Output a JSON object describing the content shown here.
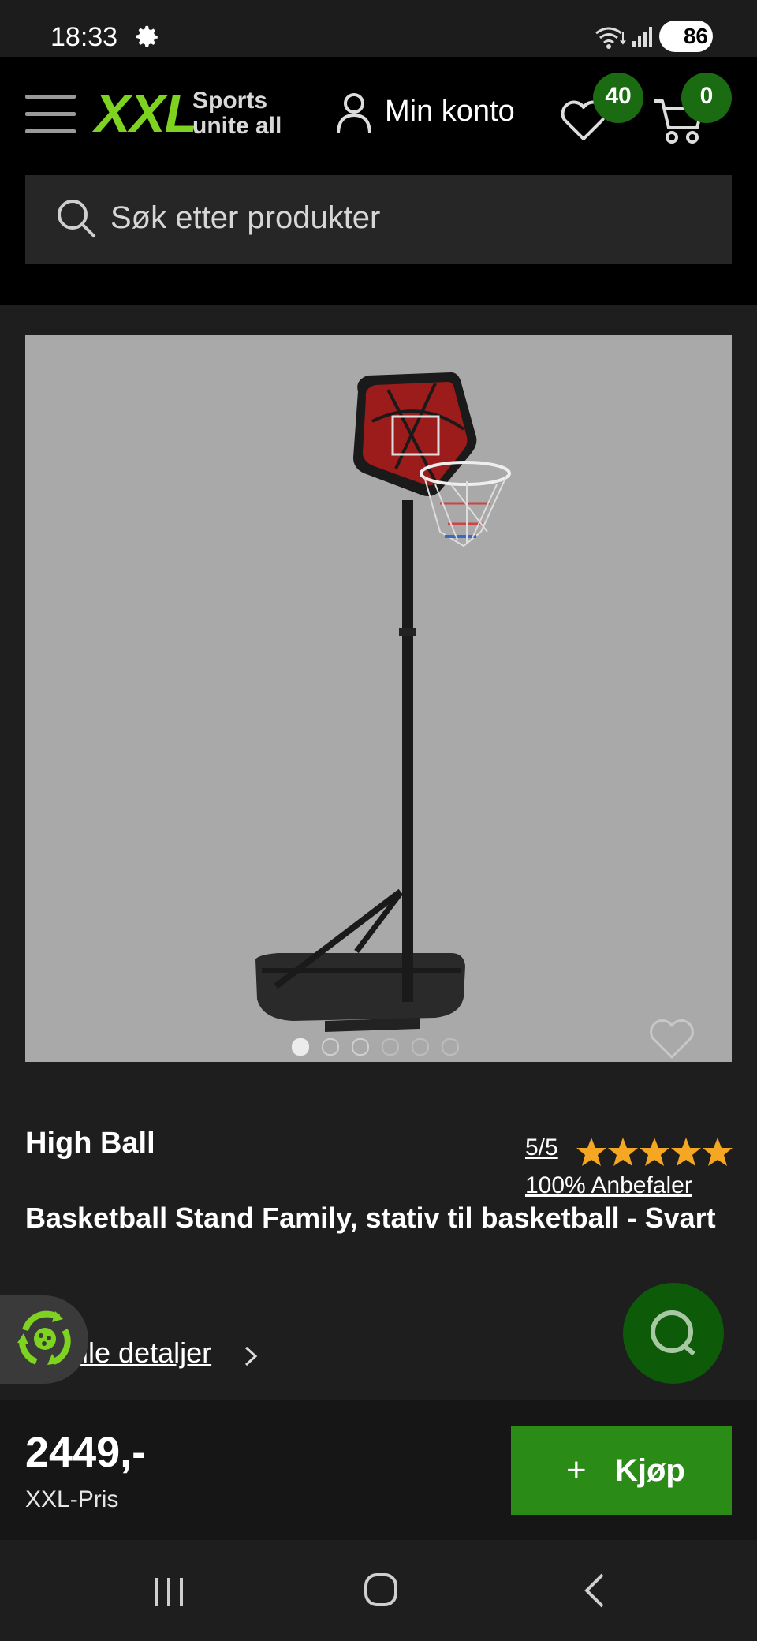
{
  "status_bar": {
    "time": "18:33",
    "battery": "86",
    "icons": [
      "gear-icon",
      "wifi-icon",
      "signal-icon",
      "battery-icon"
    ]
  },
  "header": {
    "logo": "XXL",
    "tagline_line1": "Sports",
    "tagline_line2": "unite all",
    "account_label": "Min konto",
    "wishlist_count": "40",
    "cart_count": "0",
    "brand_color": "#7ed321"
  },
  "search": {
    "placeholder": "Søk etter produkter"
  },
  "product": {
    "image_count": 6,
    "active_image": 1,
    "brand": "High Ball",
    "rating": "5/5",
    "rating_stars": 5,
    "recommend": "100% Anbefaler",
    "title": "Basketball Stand Family, stativ til basketball - Svart",
    "details_link": "alle detaljer"
  },
  "purchase": {
    "price": "2449,-",
    "price_label": "XXL-Pris",
    "buy_label": "Kjøp",
    "buy_color": "#2a8c17"
  },
  "nav": {
    "icons": [
      "recent-apps-icon",
      "home-icon",
      "back-icon"
    ]
  }
}
